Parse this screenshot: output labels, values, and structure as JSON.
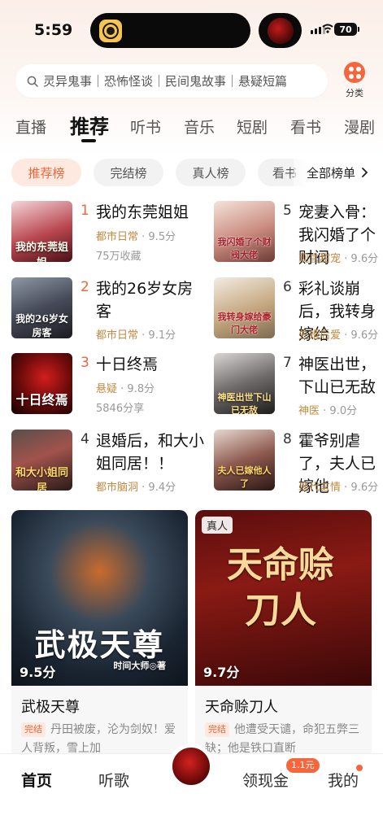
{
  "status_bar": {
    "time": "5:59",
    "battery": "70"
  },
  "search": {
    "placeholder": "灵异鬼事｜恐怖怪谈｜民间鬼故事｜悬疑短篇"
  },
  "category": {
    "label": "分类"
  },
  "tabs": [
    {
      "label": "直播"
    },
    {
      "label": "推荐"
    },
    {
      "label": "听书"
    },
    {
      "label": "音乐"
    },
    {
      "label": "短剧"
    },
    {
      "label": "看书"
    },
    {
      "label": "漫剧"
    }
  ],
  "chips": [
    {
      "label": "推荐榜"
    },
    {
      "label": "完结榜"
    },
    {
      "label": "真人榜"
    },
    {
      "label": "看书"
    }
  ],
  "chips_all": "全部榜单",
  "ranking": [
    {
      "rank": "1",
      "title": "我的东莞姐姐",
      "genre": "都市日常",
      "score": "9.5分",
      "stat": "75万收藏",
      "cover_text": "我的东莞姐姐"
    },
    {
      "rank": "2",
      "title": "我的26岁女房客",
      "genre": "都市日常",
      "score": "9.1分",
      "stat": "",
      "cover_text": "我的26岁女房客"
    },
    {
      "rank": "3",
      "title": "十日终焉",
      "genre": "悬疑",
      "score": "9.8分",
      "stat": "5846分享",
      "cover_text": "十日终焉"
    },
    {
      "rank": "4",
      "title": "退婚后，和大小姐同居！！",
      "genre": "都市脑洞",
      "score": "9.4分",
      "stat": "",
      "cover_text": "和大小姐同居"
    },
    {
      "rank": "5",
      "title": "宠妻入骨：我闪婚了个财阀",
      "genre": "现言甜宠",
      "score": "9.6分",
      "stat": "",
      "cover_text": "我闪婚了个财阀大佬"
    },
    {
      "rank": "6",
      "title": "彩礼谈崩后，我转身嫁给",
      "genre": "先婚后爱",
      "score": "9.6分",
      "stat": "",
      "cover_text": "我转身嫁给豪门大佬"
    },
    {
      "rank": "7",
      "title": "神医出世，下山已无敌",
      "genre": "神医",
      "score": "9.0分",
      "stat": "",
      "cover_text": "神医出世下山已无敌"
    },
    {
      "rank": "8",
      "title": "霍爷别虐了，夫人已嫁他",
      "genre": "现代言情",
      "score": "9.6分",
      "stat": "",
      "cover_text": "夫人已嫁他人了"
    }
  ],
  "cards": [
    {
      "title": "武极天尊",
      "score": "9.5分",
      "tag": "完结",
      "desc": "丹田被废，沦为剑奴！爱人背叛，雪上加",
      "cover_text": "武极天尊",
      "cover_author": "时间大师◎著",
      "badge": ""
    },
    {
      "title": "天命赊刀人",
      "score": "9.7分",
      "tag": "完结",
      "desc": "他遭受天谴，命犯五弊三缺；他是铁口直断",
      "cover_text": "天命赊刀人",
      "cover_author": "",
      "badge": "真人"
    }
  ],
  "bottom_nav": [
    {
      "label": "首页"
    },
    {
      "label": "听歌"
    },
    {
      "label": "领现金"
    },
    {
      "label": "我的"
    }
  ],
  "nav_badge": "1.1元",
  "colors": {
    "accent": "#f0653a",
    "genre": "#c28a40",
    "chip_active_bg": "#fde9df"
  }
}
